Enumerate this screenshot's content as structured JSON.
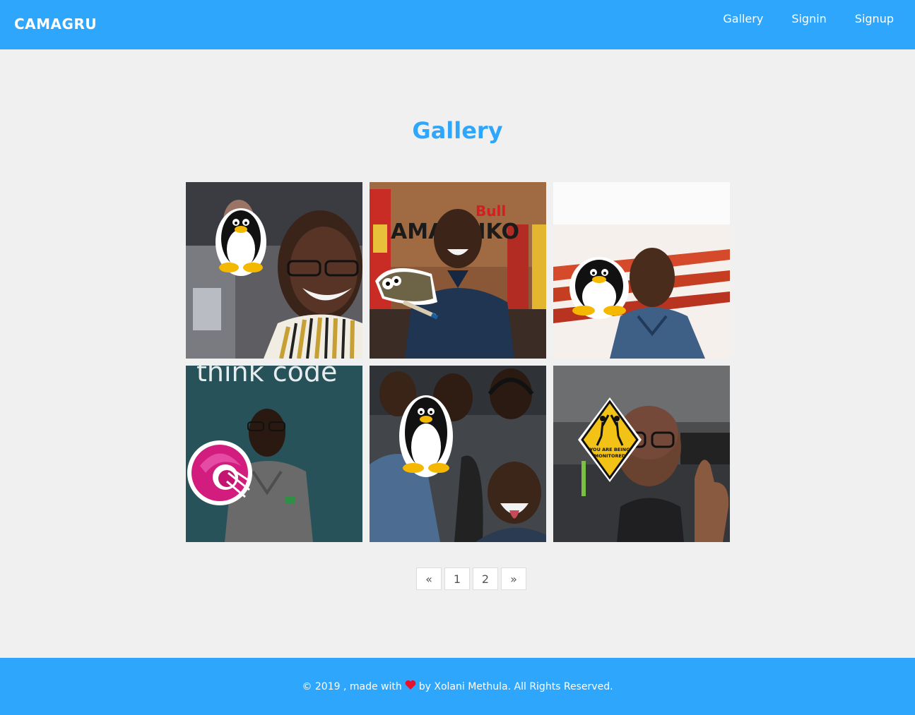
{
  "brand": "CAMAGRU",
  "colors": {
    "primary": "#2ea6fb",
    "background": "#f0f0f0",
    "heart": "#e8102c"
  },
  "nav": {
    "items": [
      "Gallery",
      "Signin",
      "Signup"
    ]
  },
  "page": {
    "title": "Gallery"
  },
  "gallery": {
    "items": [
      {
        "sticker": "tux-penguin-icon"
      },
      {
        "sticker": "gimp-wilber-icon"
      },
      {
        "sticker": "tux-penguin-icon"
      },
      {
        "sticker": "rxjs-icon",
        "scene_text": "think code"
      },
      {
        "sticker": "tux-penguin-icon"
      },
      {
        "sticker": "warning-sign-icon",
        "sticker_text": "YOU ARE BEING MONITORED"
      }
    ]
  },
  "pagination": {
    "prev": "«",
    "pages": [
      "1",
      "2"
    ],
    "next": "»"
  },
  "footer": {
    "prefix": "© 2019 , made with",
    "icon": "heart-icon",
    "suffix": "by Xolani Methula. All Rights Reserved."
  }
}
